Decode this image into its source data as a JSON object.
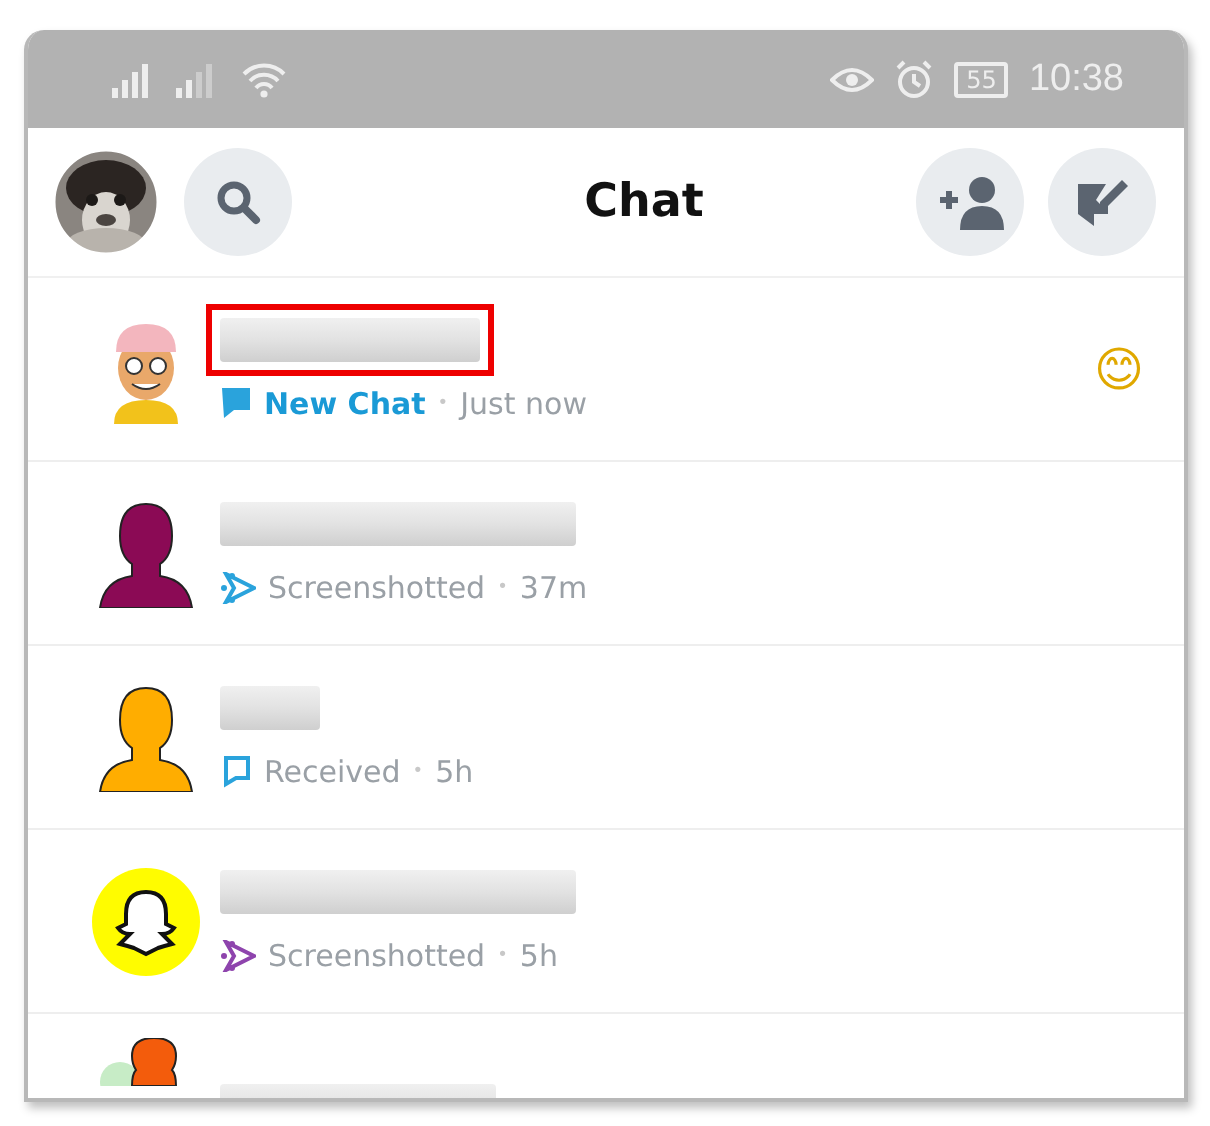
{
  "status_bar": {
    "battery": "55",
    "time": "10:38"
  },
  "header": {
    "title": "Chat"
  },
  "chats": [
    {
      "avatar": {
        "kind": "bitmoji"
      },
      "highlighted": true,
      "kind": "new",
      "status": "New Chat",
      "separator": "•",
      "time": "Just now",
      "color": "#2aa3dc",
      "emoji": "😊"
    },
    {
      "avatar": {
        "kind": "silhouette",
        "color": "#8b0a55"
      },
      "highlighted": false,
      "kind": "screenshot",
      "status": "Screenshotted",
      "separator": "•",
      "time": "37m",
      "color": "#2aa3dc"
    },
    {
      "avatar": {
        "kind": "silhouette",
        "color": "#ffad00"
      },
      "highlighted": false,
      "kind": "received",
      "status": "Received",
      "separator": "•",
      "time": "5h",
      "color": "#2aa3dc"
    },
    {
      "avatar": {
        "kind": "ghost",
        "color": "#fffc00"
      },
      "highlighted": false,
      "kind": "screenshot",
      "status": "Screenshotted",
      "separator": "•",
      "time": "5h",
      "color": "#8e44ad"
    },
    {
      "avatar": {
        "kind": "group",
        "color": "#f35c0c"
      },
      "highlighted": false
    }
  ]
}
